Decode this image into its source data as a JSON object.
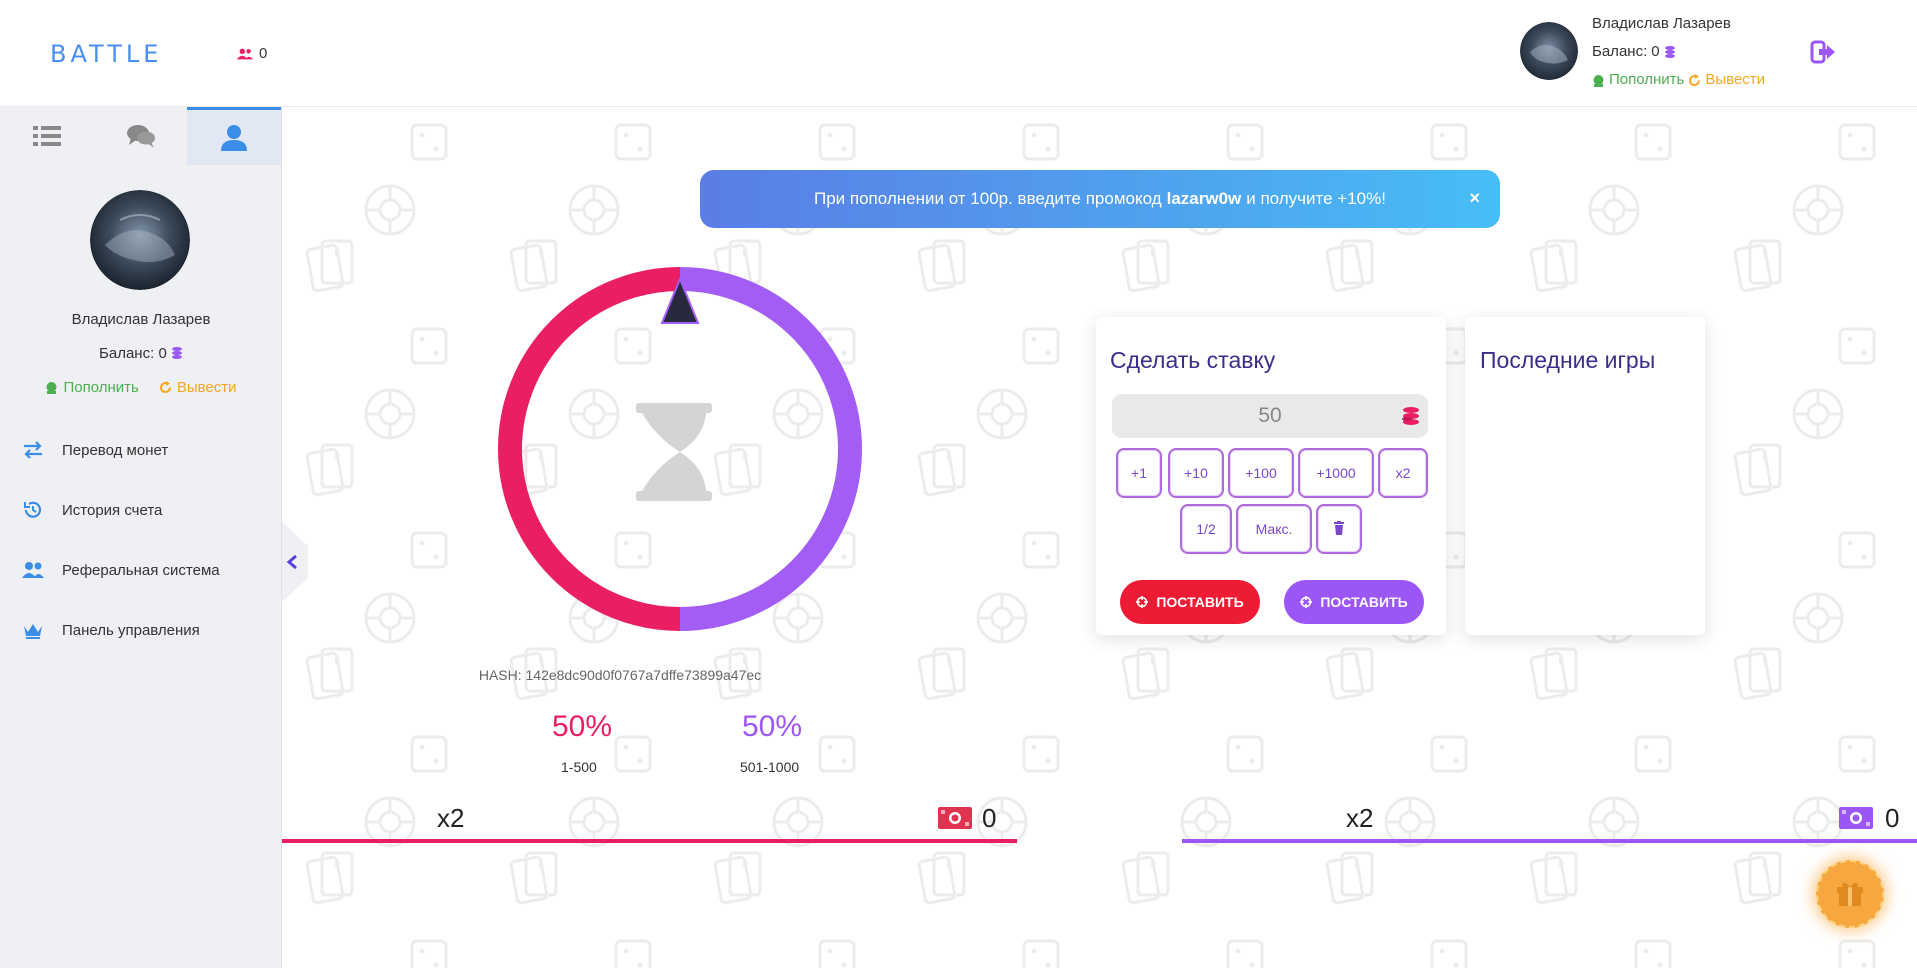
{
  "header": {
    "logo": "BATTLE",
    "online_count": "0",
    "user_name": "Владислав Лазарев",
    "balance_label": "Баланс:",
    "balance_value": "0",
    "deposit_label": "Пополнить",
    "withdraw_label": "Вывести"
  },
  "sidebar": {
    "tabs": [
      "list-icon",
      "chat-icon",
      "user-icon"
    ],
    "active_tab": "user-icon",
    "user_name": "Владислав Лазарев",
    "balance_label": "Баланс:",
    "balance_value": "0",
    "deposit_label": "Пополнить",
    "withdraw_label": "Вывести",
    "menu": [
      {
        "label": "Перевод монет",
        "icon": "transfer-icon"
      },
      {
        "label": "История счета",
        "icon": "history-icon"
      },
      {
        "label": "Реферальная система",
        "icon": "users-icon"
      },
      {
        "label": "Панель управления",
        "icon": "crown-icon"
      }
    ]
  },
  "promo": {
    "prefix": "При пополнении от 100р. введите промокод",
    "code": "lazarw0w",
    "suffix": "и получите +10%!",
    "close": "×"
  },
  "game": {
    "hash": "HASH: 142e8dc90d0f0767a7dffe73899a47ec",
    "red_percent": "50%",
    "red_range": "1-500",
    "purple_percent": "50%",
    "purple_range": "501-1000",
    "red_multiplier": "x2",
    "red_amount": "0",
    "purple_multiplier": "x2",
    "purple_amount": "0"
  },
  "bet": {
    "title": "Сделать ставку",
    "amount": "50",
    "chips": [
      "+1",
      "+10",
      "+100",
      "+1000",
      "x2",
      "1/2",
      "Макс."
    ],
    "place_red": "ПОСТАВИТЬ",
    "place_purple": "ПОСТАВИТЬ"
  },
  "games": {
    "title": "Последние игры"
  },
  "colors": {
    "red": "#e91e63",
    "purple": "#9c56f5",
    "accent": "#4a8ff0"
  }
}
